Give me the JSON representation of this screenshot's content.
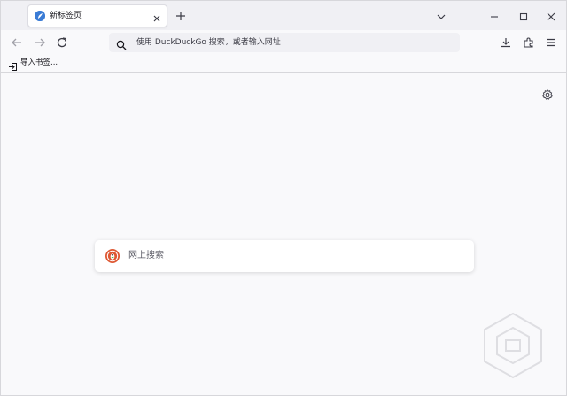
{
  "tab": {
    "title": "新标签页"
  },
  "urlbar": {
    "placeholder": "使用 DuckDuckGo 搜索，或者输入网址"
  },
  "bookmarks": {
    "import_label": "导入书签..."
  },
  "newtab": {
    "search_placeholder": "网上搜索"
  },
  "icons": {
    "tab_favicon": "firefox-logo-icon",
    "tab_close": "close-icon",
    "new_tab": "plus-icon",
    "list_tabs": "chevron-down-icon",
    "minimize": "minimize-icon",
    "maximize": "maximize-icon",
    "close_window": "close-icon",
    "back": "arrow-left-icon",
    "forward": "arrow-right-icon",
    "reload": "reload-icon",
    "search": "search-icon",
    "downloads": "download-icon",
    "extensions": "puzzle-icon",
    "menu": "hamburger-menu-icon",
    "import": "import-icon",
    "settings": "gear-icon",
    "search_engine": "duckduckgo-icon"
  },
  "colors": {
    "accent": "#3a7bd5",
    "ddg": "#de5833"
  }
}
